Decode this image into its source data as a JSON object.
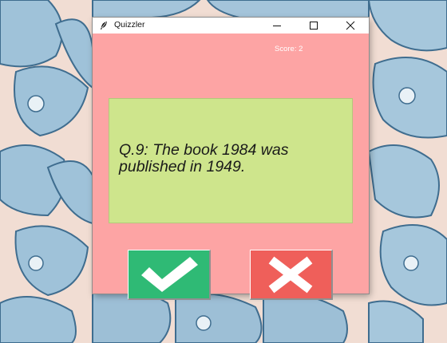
{
  "window": {
    "title": "Quizzler",
    "app_icon": "feather-icon",
    "controls": {
      "minimize": "minimize-icon",
      "maximize": "maximize-icon",
      "close": "close-icon"
    }
  },
  "quiz": {
    "score_text": "Score: 2",
    "question_text": "Q.9: The book 1984 was published in 1949."
  },
  "buttons": {
    "true_icon": "check-icon",
    "false_icon": "cross-icon"
  },
  "colors": {
    "background": "#fda4a4",
    "card": "#cee58c",
    "true_button": "#2fba75",
    "false_button": "#ef5f5a"
  }
}
